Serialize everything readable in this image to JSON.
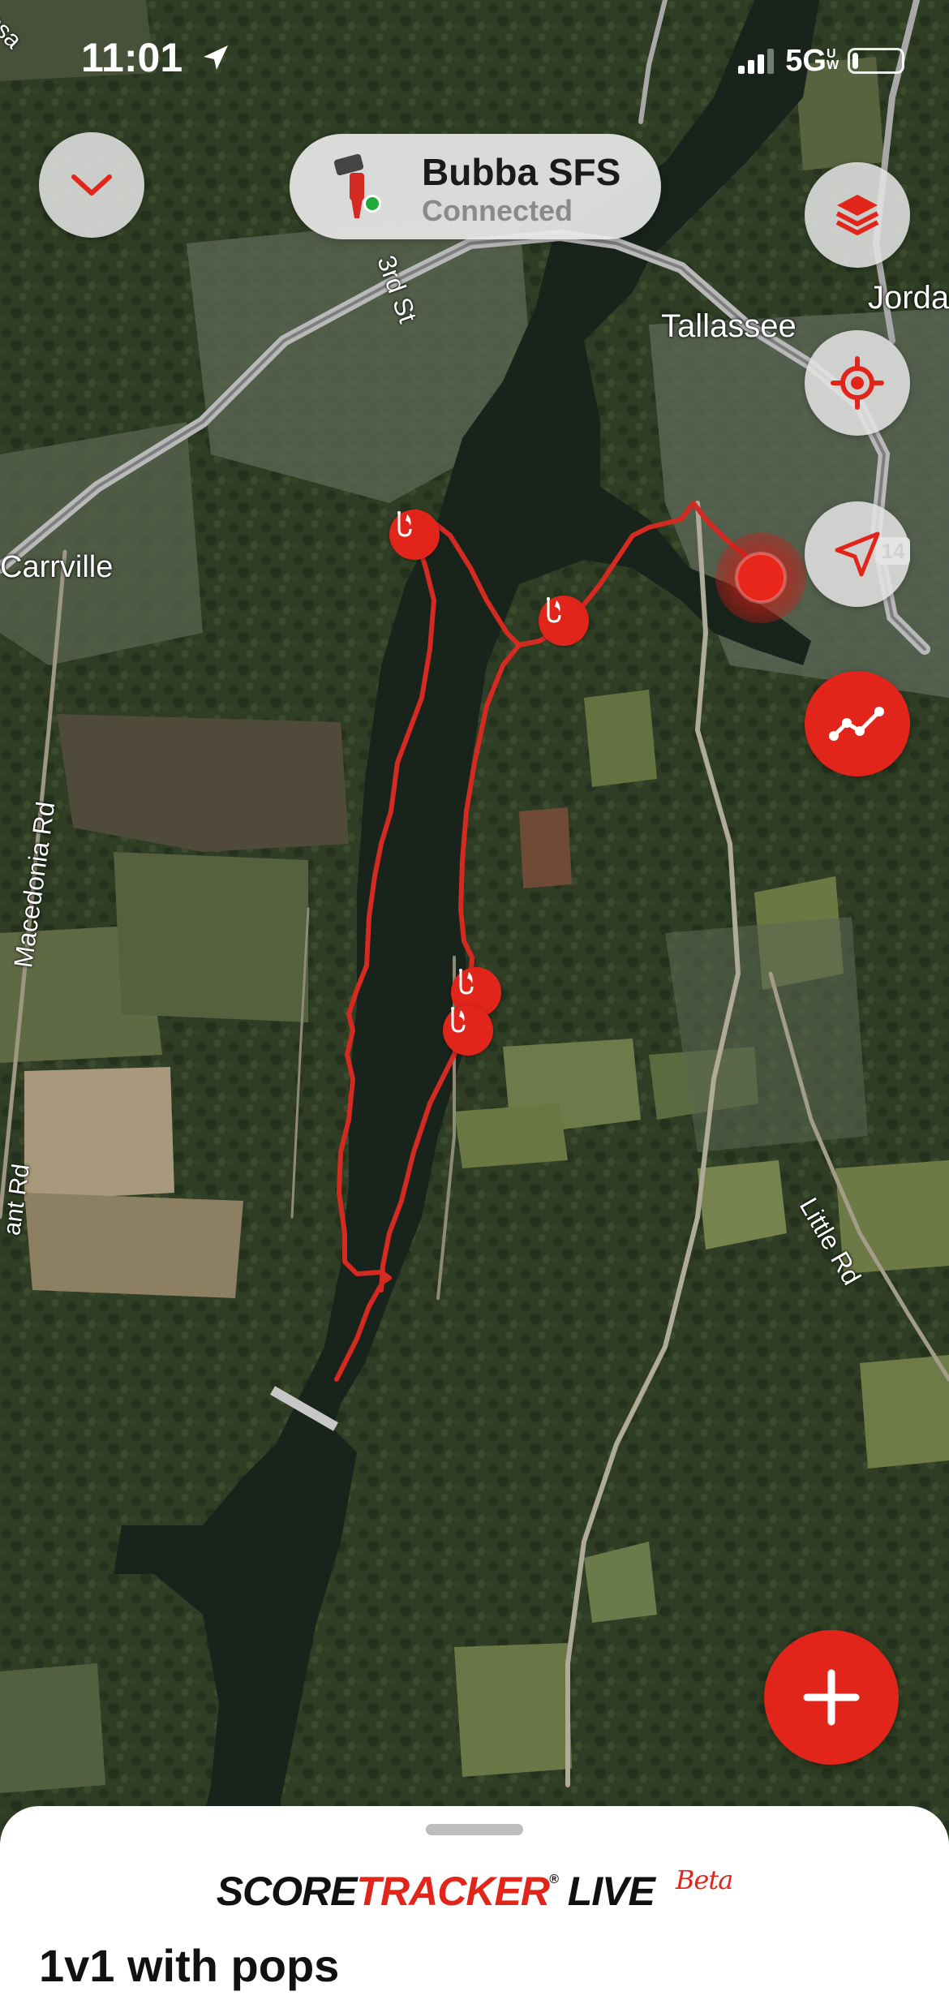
{
  "status_bar": {
    "time": "11:01",
    "network": "5G",
    "network_sub": "UW",
    "battery_level": 0.12
  },
  "header": {
    "device_name": "Bubba SFS",
    "device_status": "Connected"
  },
  "map": {
    "labels": {
      "tallassee": "Tallassee",
      "jordan": "Jorda",
      "carrville": "Carrville",
      "third_st": "3rd St",
      "macedonia_rd": "Macedonia Rd",
      "little_rd": "Little Rd",
      "mill_rd": "ant Rd",
      "top_left": "ssa",
      "route_shield": "14"
    },
    "catch_marker_count": 4
  },
  "controls": {
    "collapse_icon": "chevron-down-icon",
    "layers_icon": "layers-icon",
    "locate_icon": "target-icon",
    "navigate_icon": "navigation-arrow-icon",
    "track_icon": "track-line-icon",
    "add_icon": "plus-icon"
  },
  "colors": {
    "accent": "#e1251b",
    "button_bg": "#e4e4e4",
    "connected": "#1faa3b"
  },
  "sheet": {
    "brand_score": "SCORE",
    "brand_tracker": "TRACKER",
    "brand_reg": "®",
    "brand_live": "LIVE",
    "brand_beta": "Beta",
    "session_title": "1v1 with pops"
  }
}
